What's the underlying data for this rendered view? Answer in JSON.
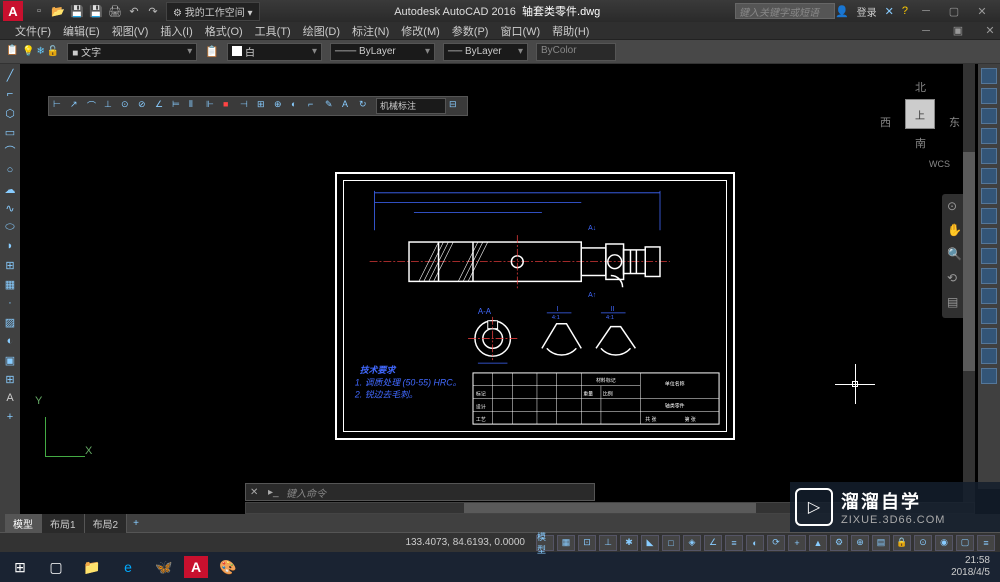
{
  "title": {
    "app": "Autodesk AutoCAD 2016",
    "file": "轴套类零件.dwg",
    "workspace": "我的工作空间",
    "search_placeholder": "键入关键字或短语",
    "login": "登录"
  },
  "menu": {
    "file": "文件(F)",
    "edit": "编辑(E)",
    "view": "视图(V)",
    "insert": "插入(I)",
    "format": "格式(O)",
    "tools": "工具(T)",
    "draw": "绘图(D)",
    "dimension": "标注(N)",
    "modify": "修改(M)",
    "param": "参数(P)",
    "window": "窗口(W)",
    "help": "帮助(H)"
  },
  "toolbar": {
    "layer_text": "文字",
    "color": "白",
    "bylayer1": "ByLayer",
    "bylayer2": "ByLayer",
    "bycolor": "ByColor",
    "dim_style": "机械标注"
  },
  "viewcube": {
    "top": "北",
    "left": "西",
    "right": "东",
    "bottom": "南",
    "face": "上",
    "wcs": "WCS"
  },
  "ucs": {
    "x": "X",
    "y": "Y"
  },
  "command": {
    "prompt": "键入命令"
  },
  "tabs": {
    "model": "模型",
    "layout1": "布局1",
    "layout2": "布局2"
  },
  "status": {
    "coords": "133.4073, 84.6193, 0.0000",
    "model": "模型"
  },
  "drawing": {
    "tech_title": "技术要求",
    "tech_1": "1. 调质处理（50-55）HRC。",
    "tech_2": "2. 锐边去毛刺。",
    "section": "A-A",
    "detail1": "I",
    "detail2": "II",
    "scale1": "4:1",
    "scale2": "4:1",
    "arrow_a": "A↓",
    "title_block": {
      "company": "单位名称",
      "material": "材料标记",
      "part_name": "轴类零件",
      "scale_label": "比例",
      "qty": "共 张 第 张"
    }
  },
  "taskbar": {
    "time": "21:58",
    "date": "2018/4/5"
  },
  "watermark": {
    "title": "溜溜自学",
    "url": "ZIXUE.3D66.COM"
  }
}
